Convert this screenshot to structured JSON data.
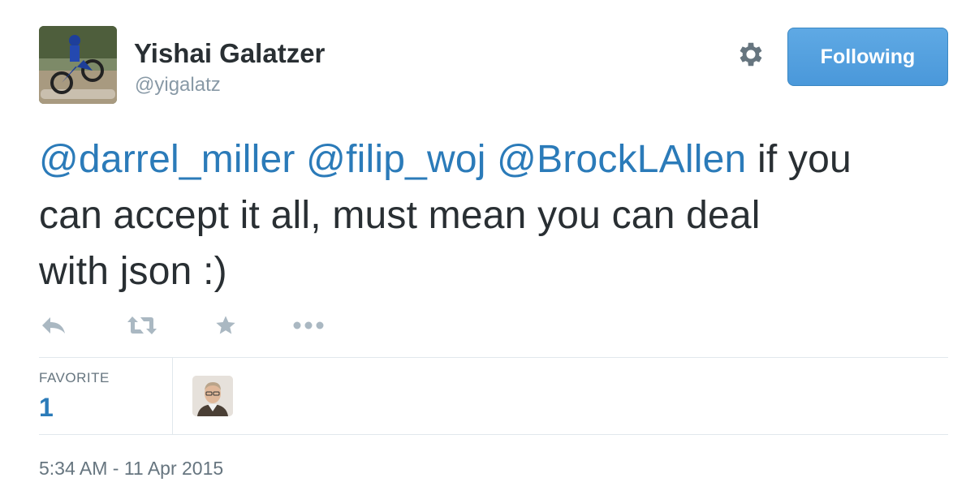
{
  "user": {
    "display_name": "Yishai Galatzer",
    "screen_name": "@yigalatz"
  },
  "header": {
    "settings_icon": "gear-icon",
    "follow_button_label": "Following"
  },
  "tweet": {
    "mentions": [
      "@darrel_miller",
      "@filip_woj",
      "@BrockLAllen"
    ],
    "text_part_1": " if you",
    "text_part_2": "can accept it all, must mean you can deal",
    "text_part_3": "with json :)"
  },
  "actions": {
    "reply_icon": "reply-icon",
    "retweet_icon": "retweet-icon",
    "favorite_icon": "star-icon",
    "more_icon": "more-icon"
  },
  "stats": {
    "favorite_label": "FAVORITE",
    "favorite_count": "1"
  },
  "timestamp": "5:34 AM - 11 Apr 2015",
  "colors": {
    "link": "#2b7bb9",
    "button": "#4a98da",
    "muted": "#8899a6",
    "text": "#292f33"
  }
}
